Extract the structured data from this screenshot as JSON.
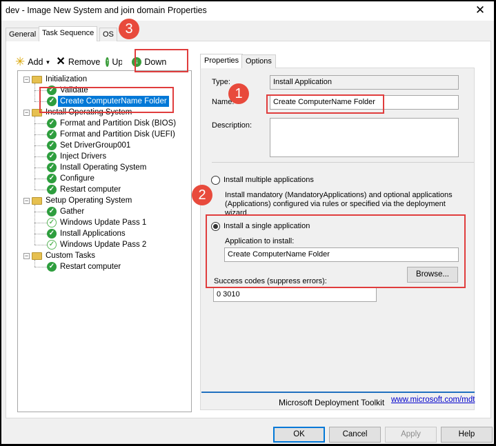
{
  "window": {
    "title": "dev - Image New System and join domain Properties",
    "close_glyph": "✕"
  },
  "top_tabs": [
    "General",
    "Task Sequence",
    "OS"
  ],
  "toolbar": {
    "add": "Add",
    "remove": "Remove",
    "up": "Up",
    "down": "Down"
  },
  "tree": {
    "groups": [
      {
        "label": "Initialization",
        "items": [
          {
            "label": "Validate",
            "icon": "check-green"
          },
          {
            "label": "Create ComputerName Folder",
            "icon": "check-green",
            "selected": true
          }
        ]
      },
      {
        "label": "Install Operating System",
        "items": [
          {
            "label": "Format and Partition Disk (BIOS)",
            "icon": "check-green"
          },
          {
            "label": "Format and Partition Disk (UEFI)",
            "icon": "check-green"
          },
          {
            "label": "Set DriverGroup001",
            "icon": "check-green"
          },
          {
            "label": "Inject Drivers",
            "icon": "check-green"
          },
          {
            "label": "Install Operating System",
            "icon": "check-green"
          },
          {
            "label": "Configure",
            "icon": "check-green"
          },
          {
            "label": "Restart computer",
            "icon": "check-green"
          }
        ]
      },
      {
        "label": "Setup Operating System",
        "items": [
          {
            "label": "Gather",
            "icon": "check-green"
          },
          {
            "label": "Windows Update Pass 1",
            "icon": "check-light"
          },
          {
            "label": "Install Applications",
            "icon": "check-green"
          },
          {
            "label": "Windows Update Pass 2",
            "icon": "check-light"
          }
        ]
      },
      {
        "label": "Custom Tasks",
        "items": [
          {
            "label": "Restart computer",
            "icon": "check-green"
          }
        ]
      }
    ]
  },
  "right_tabs": [
    "Properties",
    "Options"
  ],
  "properties": {
    "type_label": "Type:",
    "type_value": "Install Application",
    "name_label": "Name:",
    "name_value": "Create ComputerName Folder",
    "description_label": "Description:",
    "description_value": "",
    "radio_multiple": "Install multiple applications",
    "multiple_desc": "Install mandatory (MandatoryApplications) and optional applications (Applications) configured via rules or specified via the deployment wizard.",
    "radio_single": "Install a single application",
    "app_to_install_label": "Application to install:",
    "app_to_install_value": "Create ComputerName Folder",
    "browse": "Browse...",
    "success_codes_label": "Success codes (suppress errors):",
    "success_codes_value": "0 3010",
    "selected_option": "single"
  },
  "footer": {
    "mdt_text": "Microsoft Deployment Toolkit",
    "mdt_link": "www.microsoft.com/mdt"
  },
  "buttons": {
    "ok": "OK",
    "cancel": "Cancel",
    "apply": "Apply",
    "help": "Help"
  },
  "annotations": {
    "badge_1": "1",
    "badge_2": "2",
    "badge_3": "3",
    "color": "#e03c3c"
  }
}
